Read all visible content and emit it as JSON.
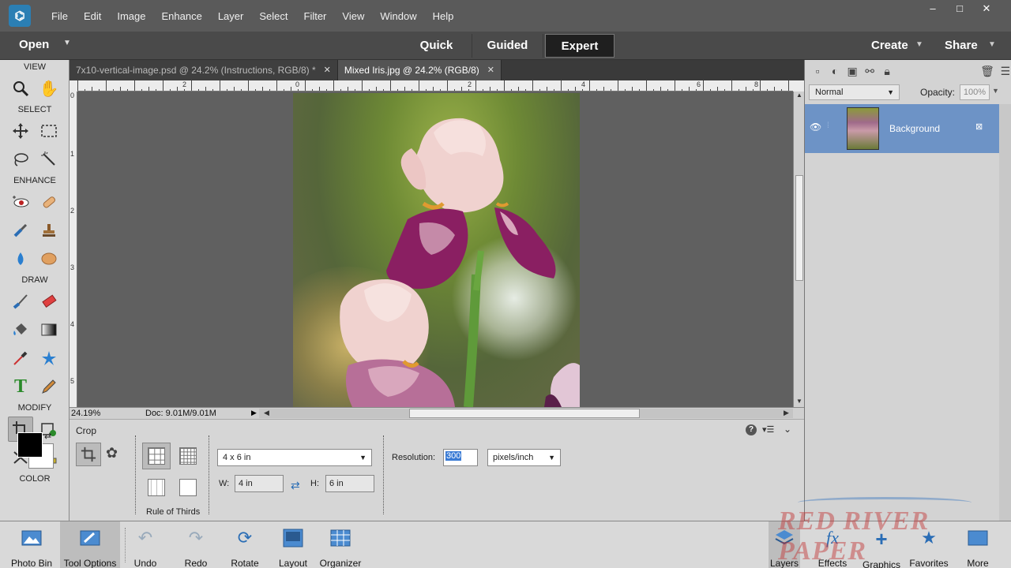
{
  "menubar": {
    "items": [
      "File",
      "Edit",
      "Image",
      "Enhance",
      "Layer",
      "Select",
      "Filter",
      "View",
      "Window",
      "Help"
    ],
    "win_min": "‒",
    "win_max": "□",
    "win_close": "✕"
  },
  "modebar": {
    "open_label": "Open",
    "tabs": [
      "Quick",
      "Guided",
      "Expert"
    ],
    "active_tab": "Expert",
    "create_label": "Create",
    "share_label": "Share"
  },
  "toolbox": {
    "sections": [
      "VIEW",
      "SELECT",
      "ENHANCE",
      "DRAW",
      "MODIFY",
      "COLOR"
    ],
    "foreground_color": "#000000",
    "background_color": "#ffffff"
  },
  "doc_tabs": [
    {
      "label": "7x10-vertical-image.psd @ 24.2% (Instructions, RGB/8) *",
      "close": "✕"
    },
    {
      "label": "Mixed Iris.jpg @ 24.2% (RGB/8)",
      "close": "✕"
    }
  ],
  "ruler": {
    "h_labels": [
      "2",
      "0",
      "2",
      "4",
      "6",
      "8"
    ],
    "v_labels": [
      "0",
      "1",
      "2",
      "3",
      "4",
      "5"
    ]
  },
  "status": {
    "zoom": "24.19%",
    "doc": "Doc: 9.01M/9.01M"
  },
  "tool_options": {
    "title": "Crop",
    "grid_label": "Rule of Thirds",
    "preset": "4 x 6 in",
    "width_label": "W:",
    "width": "4 in",
    "height_label": "H:",
    "height": "6 in",
    "resolution_label": "Resolution:",
    "resolution": "300",
    "resolution_unit": "pixels/inch",
    "help": "?"
  },
  "layers": {
    "blend_mode": "Normal",
    "opacity_label": "Opacity:",
    "opacity": "100%",
    "layer_name": "Background"
  },
  "bottombar": {
    "buttons": [
      "Photo Bin",
      "Tool Options",
      "Undo",
      "Redo",
      "Rotate",
      "Layout",
      "Organizer",
      "Layers",
      "Effects",
      "Graphics",
      "Favorites",
      "More"
    ]
  },
  "watermark": "RED RIVER PAPER",
  "colors": {
    "accent": "#2b7fb4",
    "layer_selected": "#6d93c6"
  }
}
